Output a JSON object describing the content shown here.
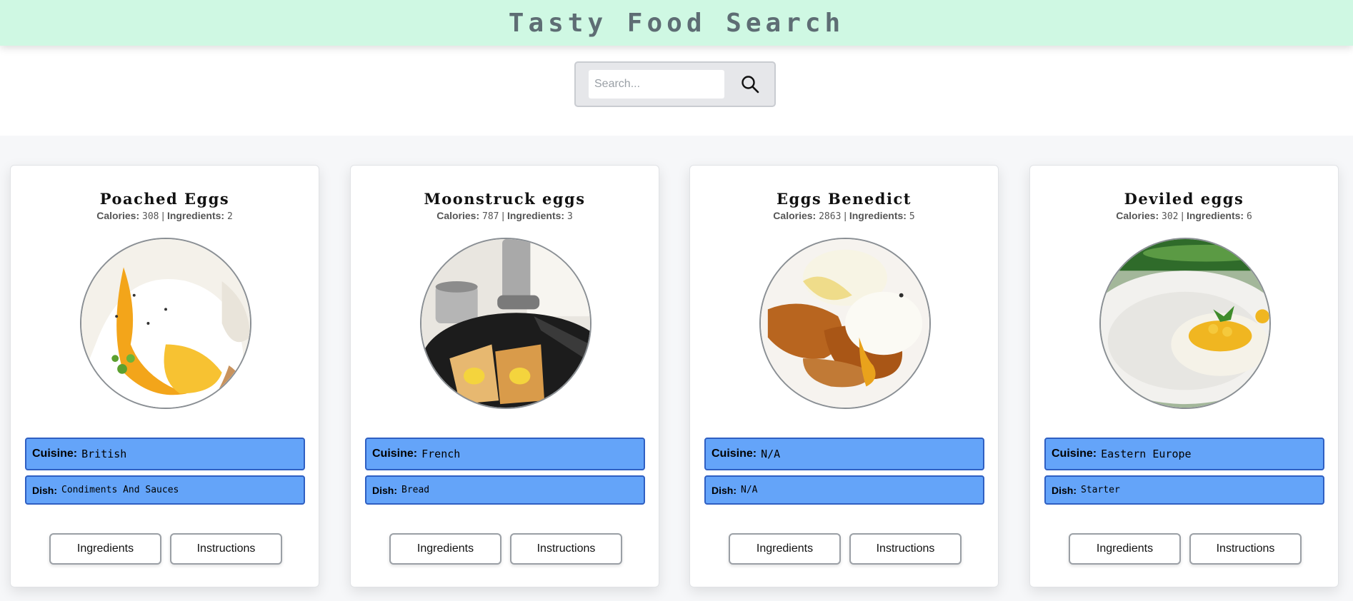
{
  "header": {
    "title": "Tasty Food Search"
  },
  "search": {
    "placeholder": "Search...",
    "value": ""
  },
  "labels": {
    "calories": "Calories:",
    "ingredients": "Ingredients:",
    "separator": "|",
    "cuisine": "Cuisine:",
    "dish": "Dish:",
    "ingredients_button": "Ingredients",
    "instructions_button": "Instructions"
  },
  "cards": [
    {
      "title": "Poached Eggs",
      "calories": "308",
      "ingredients": "2",
      "cuisine": "British",
      "dish": "Condiments And Sauces",
      "image": "poached-eggs-photo"
    },
    {
      "title": "Moonstruck eggs",
      "calories": "787",
      "ingredients": "3",
      "cuisine": "French",
      "dish": "Bread",
      "image": "moonstruck-eggs-photo"
    },
    {
      "title": "Eggs Benedict",
      "calories": "2863",
      "ingredients": "5",
      "cuisine": "N/A",
      "dish": "N/A",
      "image": "eggs-benedict-photo"
    },
    {
      "title": "Deviled eggs",
      "calories": "302",
      "ingredients": "6",
      "cuisine": "Eastern Europe",
      "dish": "Starter",
      "image": "deviled-eggs-photo"
    }
  ],
  "colors": {
    "header_bg": "#cff8e3",
    "title_text": "#5e6d74",
    "tag_bg": "#64a4f9",
    "tag_border": "#2f5fc2"
  },
  "icons": {
    "search": "search-icon"
  }
}
